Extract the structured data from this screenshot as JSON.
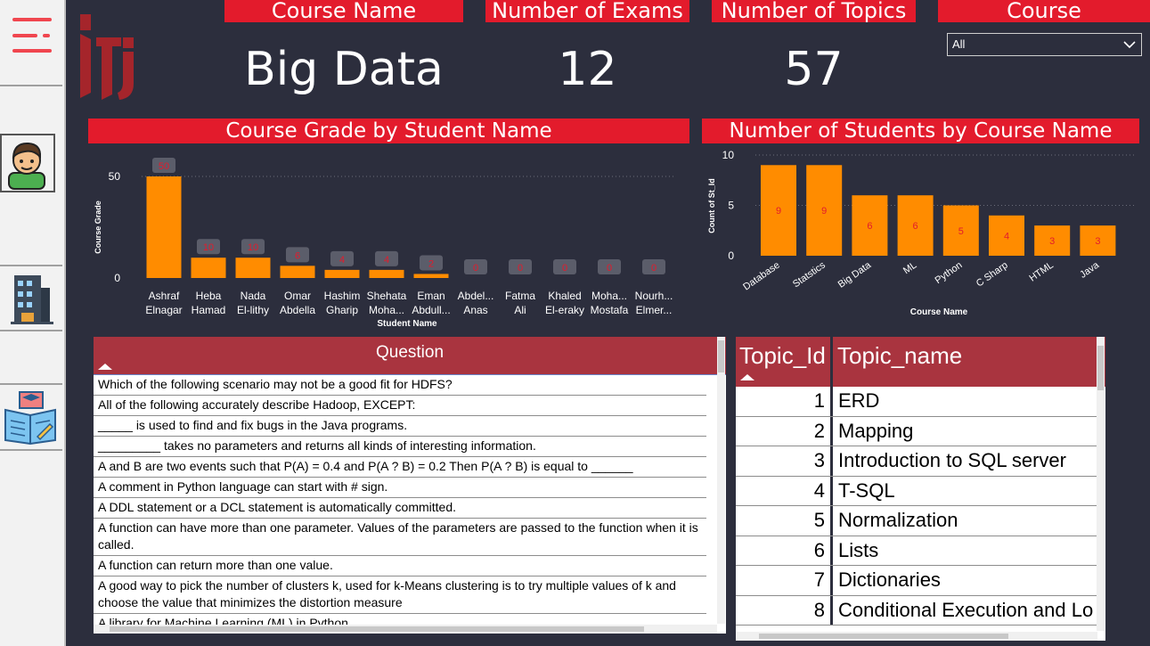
{
  "nav": {
    "items": [
      "menu",
      "student",
      "building",
      "education"
    ]
  },
  "kpis": {
    "course_name_label": "Course Name",
    "course_name_value": "Big Data",
    "exams_label": "Number of Exams",
    "exams_value": "12",
    "topics_label": "Number of Topics",
    "topics_value": "57",
    "course_label": "Course"
  },
  "slicer": {
    "selected": "All"
  },
  "colors": {
    "accent": "#e31b2c",
    "bar": "#ff8c00",
    "bg": "#2c2e3d",
    "table_header": "#a9343f"
  },
  "chart_data": [
    {
      "type": "bar",
      "title": "Course Grade by Student Name",
      "xlabel": "Student Name",
      "ylabel": "Course Grade",
      "ylim": [
        0,
        50
      ],
      "yticks": [
        "0",
        "50"
      ],
      "categories": [
        [
          "Ashraf",
          "Elnagar"
        ],
        [
          "Heba",
          "Hamad"
        ],
        [
          "Nada",
          "El-lithy"
        ],
        [
          "Omar",
          "Abdella"
        ],
        [
          "Hashim",
          "Gharip"
        ],
        [
          "Shehata",
          "Moha..."
        ],
        [
          "Eman",
          "Abdull..."
        ],
        [
          "Abdel...",
          "Anas"
        ],
        [
          "Fatma",
          "Ali"
        ],
        [
          "Khaled",
          "El-eraky"
        ],
        [
          "Moha...",
          "Mostafa"
        ],
        [
          "Nourh...",
          "Elmer..."
        ]
      ],
      "values": [
        50,
        10,
        10,
        6,
        4,
        4,
        2,
        0,
        0,
        0,
        0,
        0
      ],
      "labels": [
        "50",
        "10",
        "10",
        "6",
        "4",
        "4",
        "2",
        "0",
        "0",
        "0",
        "0",
        "0"
      ]
    },
    {
      "type": "bar",
      "title": "Number of Students by Course Name",
      "xlabel": "Course Name",
      "ylabel": "Count of St_Id",
      "ylim": [
        0,
        10
      ],
      "yticks": [
        "0",
        "5",
        "10"
      ],
      "categories": [
        "Database",
        "Statstics",
        "Big Data",
        "ML",
        "Python",
        "C Sharp",
        "HTML",
        "Java"
      ],
      "values": [
        9,
        9,
        6,
        6,
        5,
        4,
        3,
        3
      ],
      "labels": [
        "9",
        "9",
        "6",
        "6",
        "5",
        "4",
        "3",
        "3"
      ]
    }
  ],
  "questions": {
    "header": "Question",
    "rows": [
      "Which of the following scenario may not be a good fit for HDFS?",
      " All of the following accurately describe Hadoop, EXCEPT:",
      "_____ is used to find and fix bugs in the Java programs.",
      "_________ takes no parameters and returns all kinds of interesting information.",
      "A and B are two events such that P(A) = 0.4 and P(A ? B) = 0.2 Then P(A ? B) is equal to ______",
      "A comment in Python language can start with # sign.",
      "A DDL statement or a DCL statement is automatically committed.",
      "A function can have more than one parameter. Values of the parameters are passed to the function when it is called.",
      "A function can return more than one value.",
      "A good way to pick the number of clusters k, used for k-Means clustering is to try multiple values of k and choose the value that minimizes the distortion measure",
      "A library for Machine Learning (ML) in Python"
    ]
  },
  "topics": {
    "col_id": "Topic_Id",
    "col_name": "Topic_name",
    "rows": [
      {
        "id": "1",
        "name": "ERD"
      },
      {
        "id": "2",
        "name": "Mapping"
      },
      {
        "id": "3",
        "name": "Introduction to SQL server"
      },
      {
        "id": "4",
        "name": "T-SQL"
      },
      {
        "id": "5",
        "name": "Normalization"
      },
      {
        "id": "6",
        "name": "Lists"
      },
      {
        "id": "7",
        "name": "Dictionaries"
      },
      {
        "id": "8",
        "name": "Conditional Execution and Lo"
      }
    ]
  }
}
